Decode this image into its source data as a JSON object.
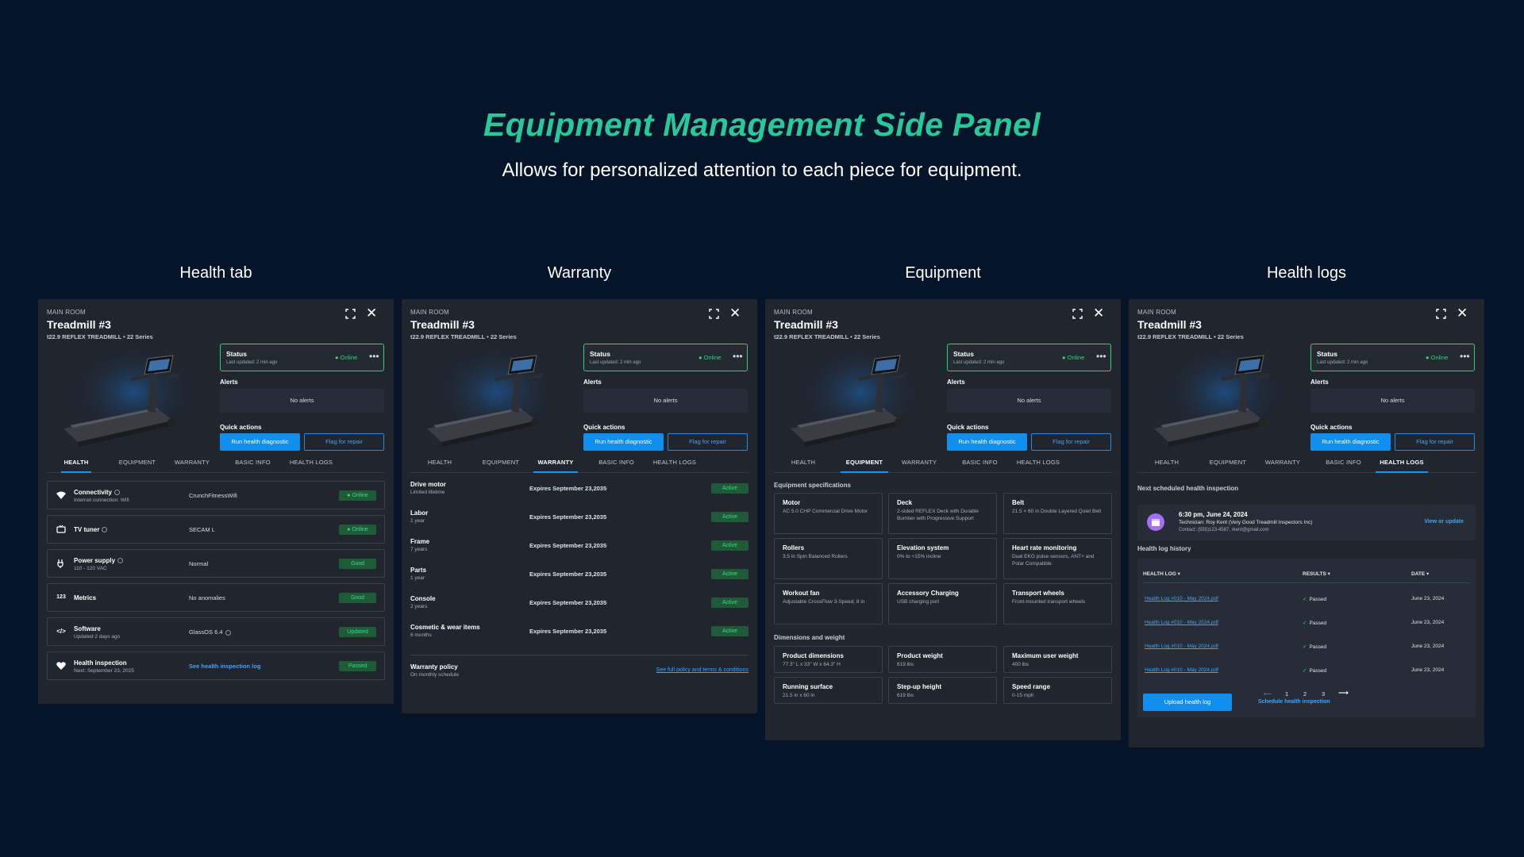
{
  "hero": {
    "title": "Equipment Management Side Panel",
    "subtitle": "Allows for personalized attention to each piece for equipment."
  },
  "columns": [
    "Health tab",
    "Warranty",
    "Equipment",
    "Health logs"
  ],
  "panel": {
    "room": "MAIN ROOM",
    "name": "Treadmill #3",
    "model": "t22.9 REFLEX TREADMILL • 22 Series",
    "status_title": "Status",
    "status_sub": "Last updated: 2 min ago",
    "status_value": "● Online",
    "alerts_label": "Alerts",
    "alerts_empty": "No alerts",
    "quick_actions_label": "Quick actions",
    "diag_button": "Run health diagnostic",
    "flag_button": "Flag for repair",
    "tabs": [
      "HEALTH",
      "EQUIPMENT",
      "WARRANTY",
      "BASIC INFO",
      "HEALTH LOGS"
    ]
  },
  "health": [
    {
      "icon": "wifi-icon",
      "title": "Connectivity",
      "sub": "Internet connection: Wifi",
      "value": "CrunchFitnessWifi",
      "status": "● Online"
    },
    {
      "icon": "tv-icon",
      "title": "TV tuner",
      "sub": "",
      "value": "SECAM L",
      "status": "● Online"
    },
    {
      "icon": "power-icon",
      "title": "Power supply",
      "sub": "110 - 120 VAC",
      "value": "Normal",
      "status": "Good"
    },
    {
      "icon": "metrics-icon",
      "title": "Metrics",
      "sub": "",
      "value": "No anomalies",
      "status": "Good"
    },
    {
      "icon": "code-icon",
      "title": "Software",
      "sub": "Updated 2 days ago",
      "value": "GlassOS 6.4",
      "status": "Updated"
    },
    {
      "icon": "heart-icon",
      "title": "Health inspection",
      "sub": "Next: September 23, 2025",
      "value": "See health inspection log",
      "status": "Passed"
    }
  ],
  "warranty": {
    "rows": [
      {
        "title": "Drive motor",
        "sub": "Limited lifetime",
        "expires": "Expires September 23,2035",
        "status": "Active"
      },
      {
        "title": "Labor",
        "sub": "1 year",
        "expires": "Expires September 23,2035",
        "status": "Active"
      },
      {
        "title": "Frame",
        "sub": "7 years",
        "expires": "Expires September 23,2035",
        "status": "Active"
      },
      {
        "title": "Parts",
        "sub": "1 year",
        "expires": "Expires September 23,2035",
        "status": "Active"
      },
      {
        "title": "Console",
        "sub": "2 years",
        "expires": "Expires September 23,2035",
        "status": "Active"
      },
      {
        "title": "Cosmetic & wear items",
        "sub": "6 months",
        "expires": "Expires September 23,2035",
        "status": "Active"
      }
    ],
    "policy_title": "Warranty policy",
    "policy_sub": "On monthly schedule",
    "policy_link": "See full policy and terms & conditions"
  },
  "equipment": {
    "specs_label": "Equipment specifications",
    "specs": [
      {
        "title": "Motor",
        "desc": "AC 5.0 CHP Commercial Drive Motor"
      },
      {
        "title": "Deck",
        "desc": "2-sided REFLEX Deck with Durable Bumber with Progressive Support"
      },
      {
        "title": "Belt",
        "desc": "21.5 × 60 in Double Layered Quiet Belt"
      },
      {
        "title": "Rollers",
        "desc": "3.5 in Spin Balanced Rollers"
      },
      {
        "title": "Elevation system",
        "desc": "0% to +15% incline"
      },
      {
        "title": "Heart rate monitoring",
        "desc": "Dual EKG pulse sensors, ANT+ and Polar Compatible"
      },
      {
        "title": "Workout fan",
        "desc": "Adjustable CrossFlow 3-Speed, 8 in"
      },
      {
        "title": "Accessory Charging",
        "desc": "USB charging port"
      },
      {
        "title": "Transport wheels",
        "desc": "Front-mounted transport wheels"
      }
    ],
    "dims_label": "Dimensions and weight",
    "dims": [
      {
        "title": "Product dimensions",
        "desc": "77.3\" L x 33\" W x 64.3\" H"
      },
      {
        "title": "Product weight",
        "desc": "619 lbs"
      },
      {
        "title": "Maximum user weight",
        "desc": "400 lbs"
      },
      {
        "title": "Running surface",
        "desc": "21.5 in x 60 in"
      },
      {
        "title": "Step-up height",
        "desc": "619 lbs"
      },
      {
        "title": "Speed range",
        "desc": "0-15 mph"
      }
    ]
  },
  "logs": {
    "next_label": "Next scheduled health inspection",
    "next_time": "6:30 pm, June 24, 2024",
    "next_tech": "Technician: Roy Kent (Very Good Treadmill Inspectors Inc)",
    "next_contact": "Contact: (555)123-4567, rkent@gmail.com",
    "view_link": "View or update",
    "history_label": "Health log history",
    "col_log": "HEALTH LOG ▾",
    "col_results": "RESULTS ▾",
    "col_date": "DATE ▾",
    "rows": [
      {
        "file": "Health Log #010 - May 2024.pdf",
        "result": "Passed",
        "date": "June 23, 2024"
      },
      {
        "file": "Health Log #010 - May 2024.pdf",
        "result": "Passed",
        "date": "June 23, 2024"
      },
      {
        "file": "Health Log #010 - May 2024.pdf",
        "result": "Passed",
        "date": "June 23, 2024"
      },
      {
        "file": "Health Log #010 - May 2024.pdf",
        "result": "Passed",
        "date": "June 23, 2024"
      }
    ],
    "pages": [
      "1",
      "2",
      "3"
    ],
    "prev": "⟵",
    "next": "⟶",
    "upload_button": "Upload health log",
    "schedule_link": "Schedule health inspection"
  },
  "colors": {
    "background": "#061429",
    "accent_title": "#27c89a",
    "panel": "#20252e",
    "primary": "#0f8ff0",
    "success": "#37dc84"
  }
}
